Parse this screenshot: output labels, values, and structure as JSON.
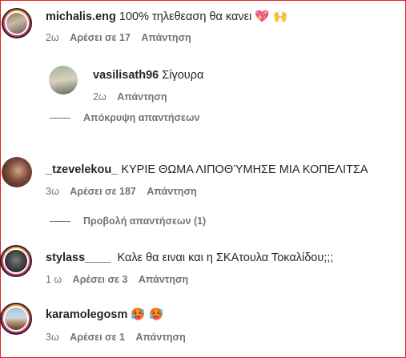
{
  "comments": [
    {
      "user": "michalis.eng",
      "text": "100% τηλεθεαση θα κανει ",
      "emojis": "💖 🙌",
      "time": "2ω",
      "likes": "Αρέσει σε 17",
      "reply": "Απάντηση"
    },
    {
      "user": "vasilisath96",
      "text": "Σίγουρα",
      "time": "2ω",
      "reply": "Απάντηση"
    },
    {
      "user": "_tzevelekou_",
      "text": "ΚΥΡΙΕ ΘΩΜΑ ΛΙΠΟΘΎΜΗΣΕ ΜΙΑ ΚΟΠΕΛΙΤΣΑ",
      "time": "3ω",
      "likes": "Αρέσει σε 187",
      "reply": "Απάντηση"
    },
    {
      "user": "stylass____",
      "text": "Καλε θα ειναι και η ΣΚΑτουλα Τοκαλίδου;;;",
      "time": "1 ω",
      "likes": "Αρέσει σε 3",
      "reply": "Απάντηση"
    },
    {
      "user": "karamolegosm",
      "emojis": "🥵 🥵",
      "time": "3ω",
      "likes": "Αρέσει σε 1",
      "reply": "Απάντηση"
    }
  ],
  "toggles": {
    "hide_replies": "Απόκρυψη απαντήσεων",
    "view_replies": "Προβολή απαντήσεων (1)"
  }
}
